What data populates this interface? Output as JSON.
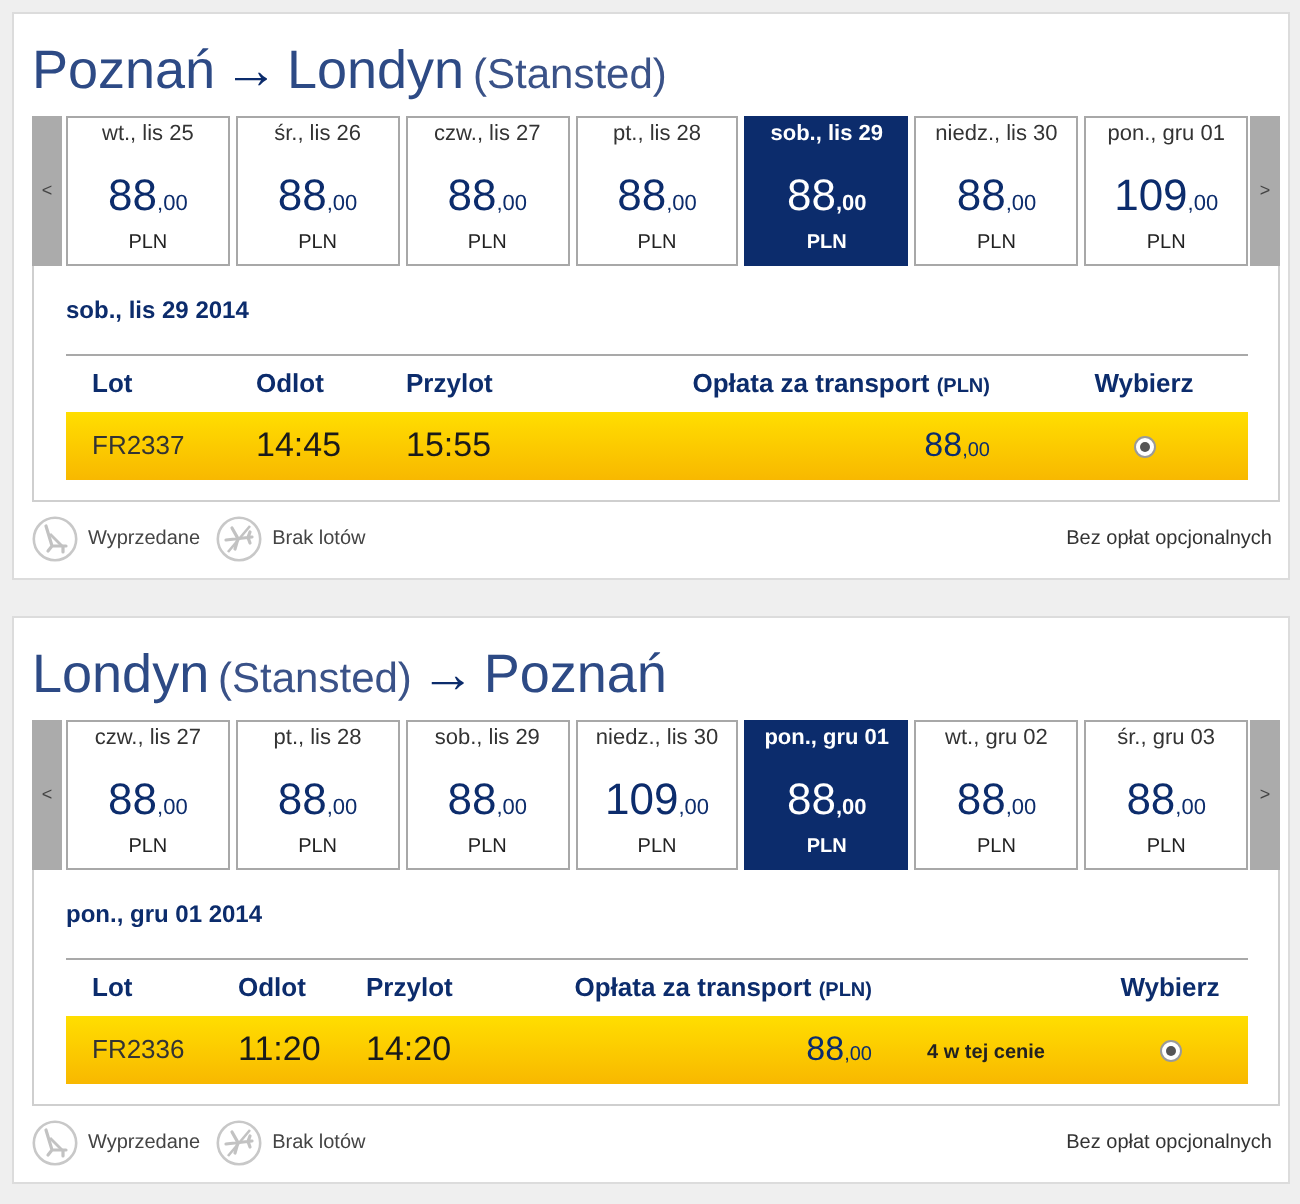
{
  "journeys": [
    {
      "title": [
        {
          "kind": "city",
          "text": "Poznań"
        },
        {
          "kind": "arrow",
          "text": "→"
        },
        {
          "kind": "city",
          "text": "Londyn"
        },
        {
          "kind": "airport",
          "text": "(Stansted)"
        }
      ],
      "date_strip": {
        "previous": "<",
        "next": ">",
        "days": [
          {
            "label": "wt., lis 25",
            "price": "88",
            "decimals": ",00",
            "currency": "PLN",
            "selected": false
          },
          {
            "label": "śr., lis 26",
            "price": "88",
            "decimals": ",00",
            "currency": "PLN",
            "selected": false
          },
          {
            "label": "czw., lis 27",
            "price": "88",
            "decimals": ",00",
            "currency": "PLN",
            "selected": false
          },
          {
            "label": "pt., lis 28",
            "price": "88",
            "decimals": ",00",
            "currency": "PLN",
            "selected": false
          },
          {
            "label": "sob., lis 29",
            "price": "88",
            "decimals": ",00",
            "currency": "PLN",
            "selected": true
          },
          {
            "label": "niedz., lis 30",
            "price": "88",
            "decimals": ",00",
            "currency": "PLN",
            "selected": false
          },
          {
            "label": "pon., gru 01",
            "price": "109",
            "decimals": ",00",
            "currency": "PLN",
            "selected": false
          }
        ]
      },
      "selected_date": "sob., lis 29 2014",
      "table": {
        "columns": [
          {
            "kind": "flight",
            "label": "Lot"
          },
          {
            "kind": "departure",
            "label": "Odlot"
          },
          {
            "kind": "arrival",
            "label": "Przylot"
          },
          {
            "kind": "fare",
            "label": "Opłata za transport",
            "unit": "(PLN)"
          },
          {
            "kind": "select",
            "label": "Wybierz"
          }
        ],
        "rows": [
          {
            "flight": "FR2337",
            "departure": "14:45",
            "arrival": "15:55",
            "price": "88",
            "decimals": ",00",
            "selected": true
          }
        ]
      },
      "legend": [
        {
          "kind": "sold_out",
          "label": "Wyprzedane"
        },
        {
          "kind": "no_flights",
          "label": "Brak lotów"
        }
      ],
      "fees_note": "Bez opłat opcjonalnych"
    },
    {
      "title": [
        {
          "kind": "city",
          "text": "Londyn"
        },
        {
          "kind": "airport",
          "text": "(Stansted)"
        },
        {
          "kind": "arrow",
          "text": "→"
        },
        {
          "kind": "city",
          "text": "Poznań"
        }
      ],
      "date_strip": {
        "previous": "<",
        "next": ">",
        "days": [
          {
            "label": "czw., lis 27",
            "price": "88",
            "decimals": ",00",
            "currency": "PLN",
            "selected": false
          },
          {
            "label": "pt., lis 28",
            "price": "88",
            "decimals": ",00",
            "currency": "PLN",
            "selected": false
          },
          {
            "label": "sob., lis 29",
            "price": "88",
            "decimals": ",00",
            "currency": "PLN",
            "selected": false
          },
          {
            "label": "niedz., lis 30",
            "price": "109",
            "decimals": ",00",
            "currency": "PLN",
            "selected": false
          },
          {
            "label": "pon., gru 01",
            "price": "88",
            "decimals": ",00",
            "currency": "PLN",
            "selected": true
          },
          {
            "label": "wt., gru 02",
            "price": "88",
            "decimals": ",00",
            "currency": "PLN",
            "selected": false
          },
          {
            "label": "śr., gru 03",
            "price": "88",
            "decimals": ",00",
            "currency": "PLN",
            "selected": false
          }
        ]
      },
      "selected_date": "pon., gru 01 2014",
      "table": {
        "columns": [
          {
            "kind": "flight",
            "label": "Lot"
          },
          {
            "kind": "departure",
            "label": "Odlot"
          },
          {
            "kind": "arrival",
            "label": "Przylot"
          },
          {
            "kind": "fare",
            "label": "Opłata za transport",
            "unit": "(PLN)"
          },
          {
            "kind": "select",
            "label": "Wybierz"
          }
        ],
        "rows": [
          {
            "flight": "FR2336",
            "departure": "11:20",
            "arrival": "14:20",
            "price": "88",
            "decimals": ",00",
            "note": "4 w tej cenie",
            "selected": true
          }
        ]
      },
      "legend": [
        {
          "kind": "sold_out",
          "label": "Wyprzedane"
        },
        {
          "kind": "no_flights",
          "label": "Brak lotów"
        }
      ],
      "fees_note": "Bez opłat opcjonalnych"
    }
  ]
}
